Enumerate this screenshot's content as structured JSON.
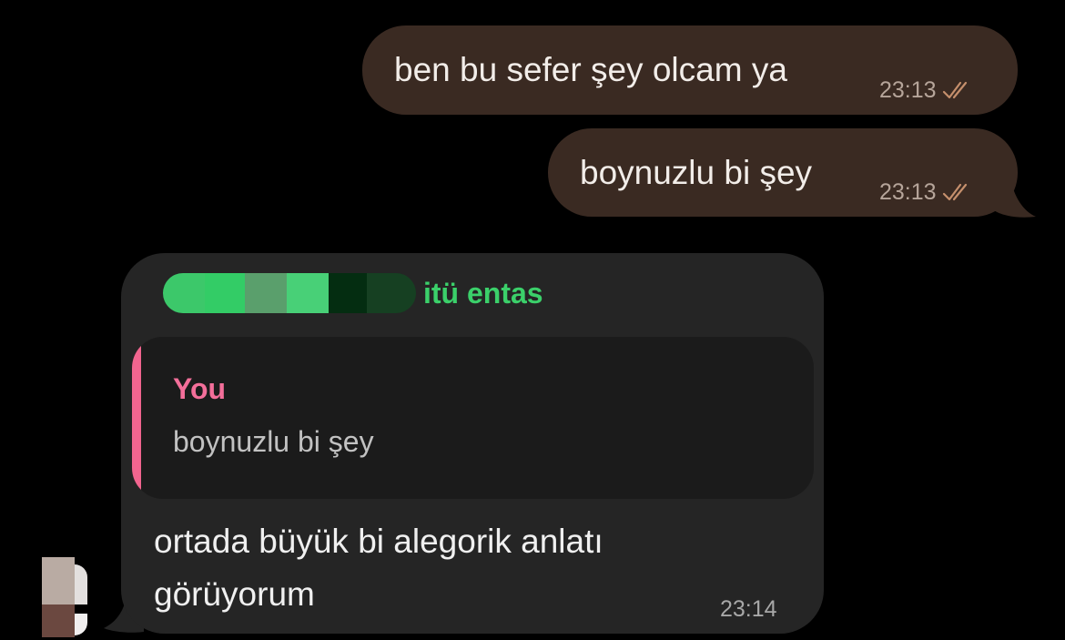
{
  "messages_out": [
    {
      "text": "ben bu sefer şey olcam ya",
      "time": "23:13",
      "status_icon": "double-check-icon"
    },
    {
      "text": "boynuzlu bi şey",
      "time": "23:13",
      "status_icon": "double-check-icon"
    }
  ],
  "message_in": {
    "sender_suffix": "itü entas",
    "reply": {
      "author": "You",
      "text": "boynuzlu bi şey"
    },
    "text_lines": [
      "ortada büyük bi alegorik anlatı",
      "görüyorum"
    ],
    "time": "23:14"
  },
  "colors": {
    "background": "#000000",
    "outgoing_bubble": "#3a2a22",
    "incoming_bubble": "#252525",
    "sender_name": "#3bd06a",
    "reply_accent": "#f2658f",
    "read_ticks": "#c58f6c"
  }
}
